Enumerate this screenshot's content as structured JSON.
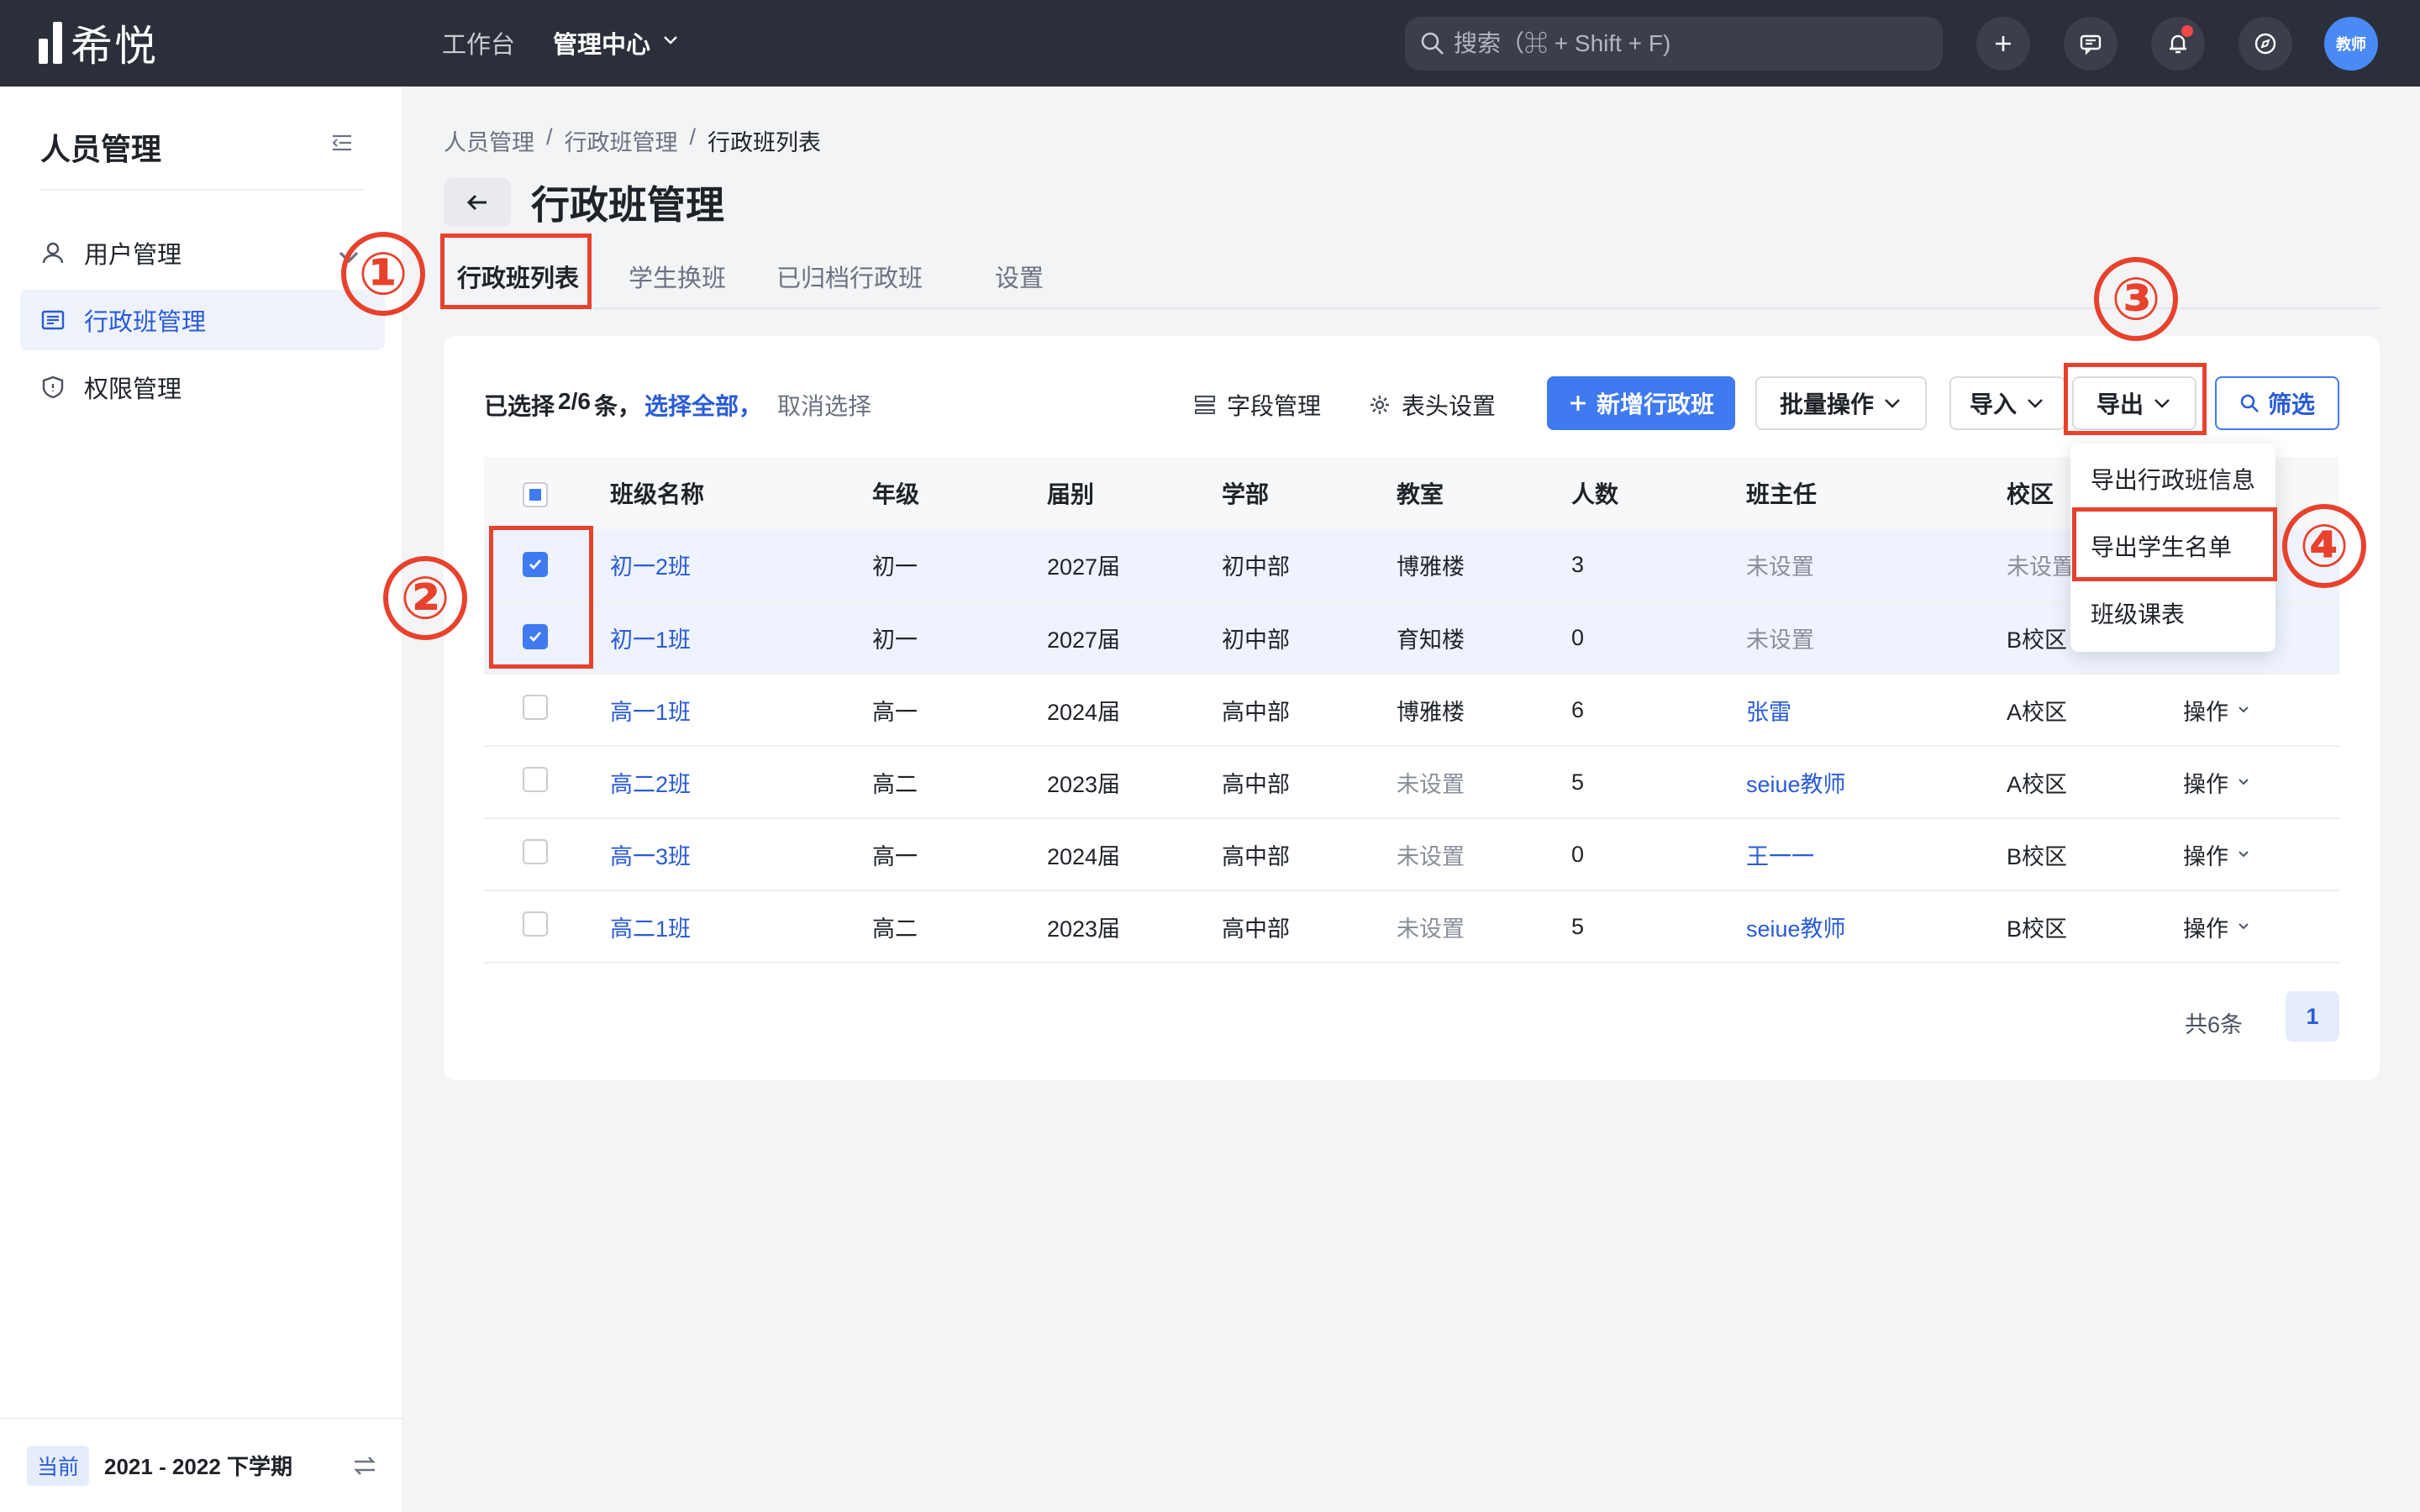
{
  "topbar": {
    "logo_text": "希悦",
    "nav": [
      "工作台",
      "管理中心"
    ],
    "search_placeholder": "搜索（⌘ + Shift + F)",
    "avatar_label": "教师",
    "icons": [
      "plus-icon",
      "message-icon",
      "bell-icon",
      "compass-icon"
    ]
  },
  "sidebar": {
    "title": "人员管理",
    "items": [
      {
        "label": "用户管理",
        "icon": "user-icon"
      },
      {
        "label": "行政班管理",
        "icon": "class-list-icon"
      },
      {
        "label": "权限管理",
        "icon": "shield-icon"
      }
    ],
    "footer_tag": "当前",
    "footer_term": "2021 - 2022 下学期"
  },
  "breadcrumb": [
    "人员管理",
    "/",
    "行政班管理",
    "/",
    "行政班列表"
  ],
  "page_title": "行政班管理",
  "tabs": [
    "行政班列表",
    "学生换班",
    "已归档行政班",
    "设置"
  ],
  "toolbar": {
    "selected_prefix": "已选择",
    "selected_count": "2/6",
    "selected_suffix": "条，",
    "select_all": "选择全部，",
    "cancel_select": "取消选择",
    "field_manage": "字段管理",
    "header_settings": "表头设置",
    "add_class": "新增行政班",
    "batch_ops": "批量操作",
    "import": "导入",
    "export": "导出",
    "filter": "筛选"
  },
  "table": {
    "headers": [
      "班级名称",
      "年级",
      "届别",
      "学部",
      "教室",
      "人数",
      "班主任",
      "校区"
    ],
    "rows": [
      {
        "name": "初一2班",
        "grade": "初一",
        "year": "2027届",
        "dept": "初中部",
        "room": "博雅楼",
        "count": "3",
        "teacher": "未设置",
        "campus": "未设置",
        "op": "",
        "checked": true
      },
      {
        "name": "初一1班",
        "grade": "初一",
        "year": "2027届",
        "dept": "初中部",
        "room": "育知楼",
        "count": "0",
        "teacher": "未设置",
        "campus": "B校区",
        "op": "",
        "checked": true
      },
      {
        "name": "高一1班",
        "grade": "高一",
        "year": "2024届",
        "dept": "高中部",
        "room": "博雅楼",
        "count": "6",
        "teacher": "张雷",
        "campus": "A校区",
        "op": "操作",
        "checked": false
      },
      {
        "name": "高二2班",
        "grade": "高二",
        "year": "2023届",
        "dept": "高中部",
        "room": "未设置",
        "count": "5",
        "teacher": "seiue教师",
        "campus": "A校区",
        "op": "操作",
        "checked": false
      },
      {
        "name": "高一3班",
        "grade": "高一",
        "year": "2024届",
        "dept": "高中部",
        "room": "未设置",
        "count": "0",
        "teacher": "王一一",
        "campus": "B校区",
        "op": "操作",
        "checked": false
      },
      {
        "name": "高二1班",
        "grade": "高二",
        "year": "2023届",
        "dept": "高中部",
        "room": "未设置",
        "count": "5",
        "teacher": "seiue教师",
        "campus": "B校区",
        "op": "操作",
        "checked": false
      }
    ]
  },
  "pagination": {
    "total": "共6条",
    "page": "1"
  },
  "export_menu": [
    "导出行政班信息",
    "导出学生名单",
    "班级课表"
  ],
  "annotations": [
    "①",
    "②",
    "③",
    "④"
  ],
  "colors": {
    "accent": "#3f7af0",
    "annotation": "#e8412c",
    "topbar": "#2b2f3a"
  }
}
